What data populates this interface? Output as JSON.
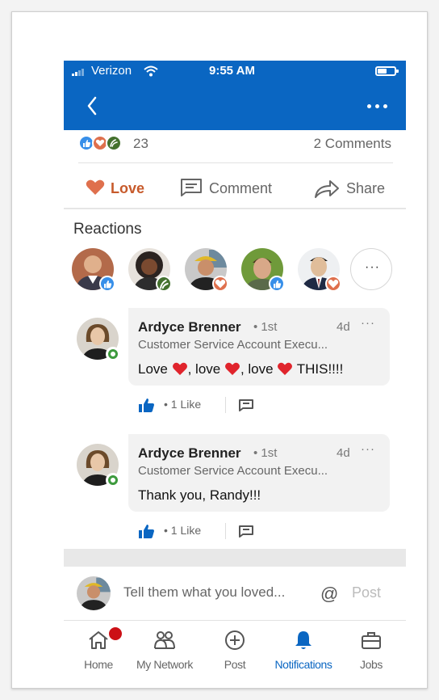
{
  "status_bar": {
    "carrier": "Verizon",
    "time": "9:55 AM"
  },
  "summary": {
    "reaction_count": "23",
    "comments_count": "2 Comments"
  },
  "actions": {
    "love_label": "Love",
    "comment_label": "Comment",
    "share_label": "Share"
  },
  "reactions": {
    "title": "Reactions",
    "more_label": "···"
  },
  "comments": [
    {
      "name": "Ardyce Brenner",
      "degree": "• 1st",
      "time": "4d",
      "more": "···",
      "headline": "Customer Service Account Execu...",
      "text_parts": [
        "Love ",
        ", love ",
        ", love ",
        " THIS!!!!"
      ],
      "like_text": "•  1 Like"
    },
    {
      "name": "Ardyce Brenner",
      "degree": "• 1st",
      "time": "4d",
      "more": "···",
      "headline": "Customer Service Account Execu...",
      "text": "Thank you, Randy!!!",
      "like_text": "•  1 Like"
    }
  ],
  "compose": {
    "placeholder": "Tell them what you loved...",
    "mention": "@",
    "post_label": "Post"
  },
  "tabs": [
    {
      "label": "Home",
      "icon": "home-icon"
    },
    {
      "label": "My Network",
      "icon": "network-icon"
    },
    {
      "label": "Post",
      "icon": "post-icon"
    },
    {
      "label": "Notifications",
      "icon": "bell-icon",
      "active": true
    },
    {
      "label": "Jobs",
      "icon": "briefcase-icon"
    }
  ],
  "colors": {
    "brand": "#0a66c2",
    "love": "#c75a2b",
    "online": "#3d9a3d",
    "notification_dot": "#cc1016"
  }
}
